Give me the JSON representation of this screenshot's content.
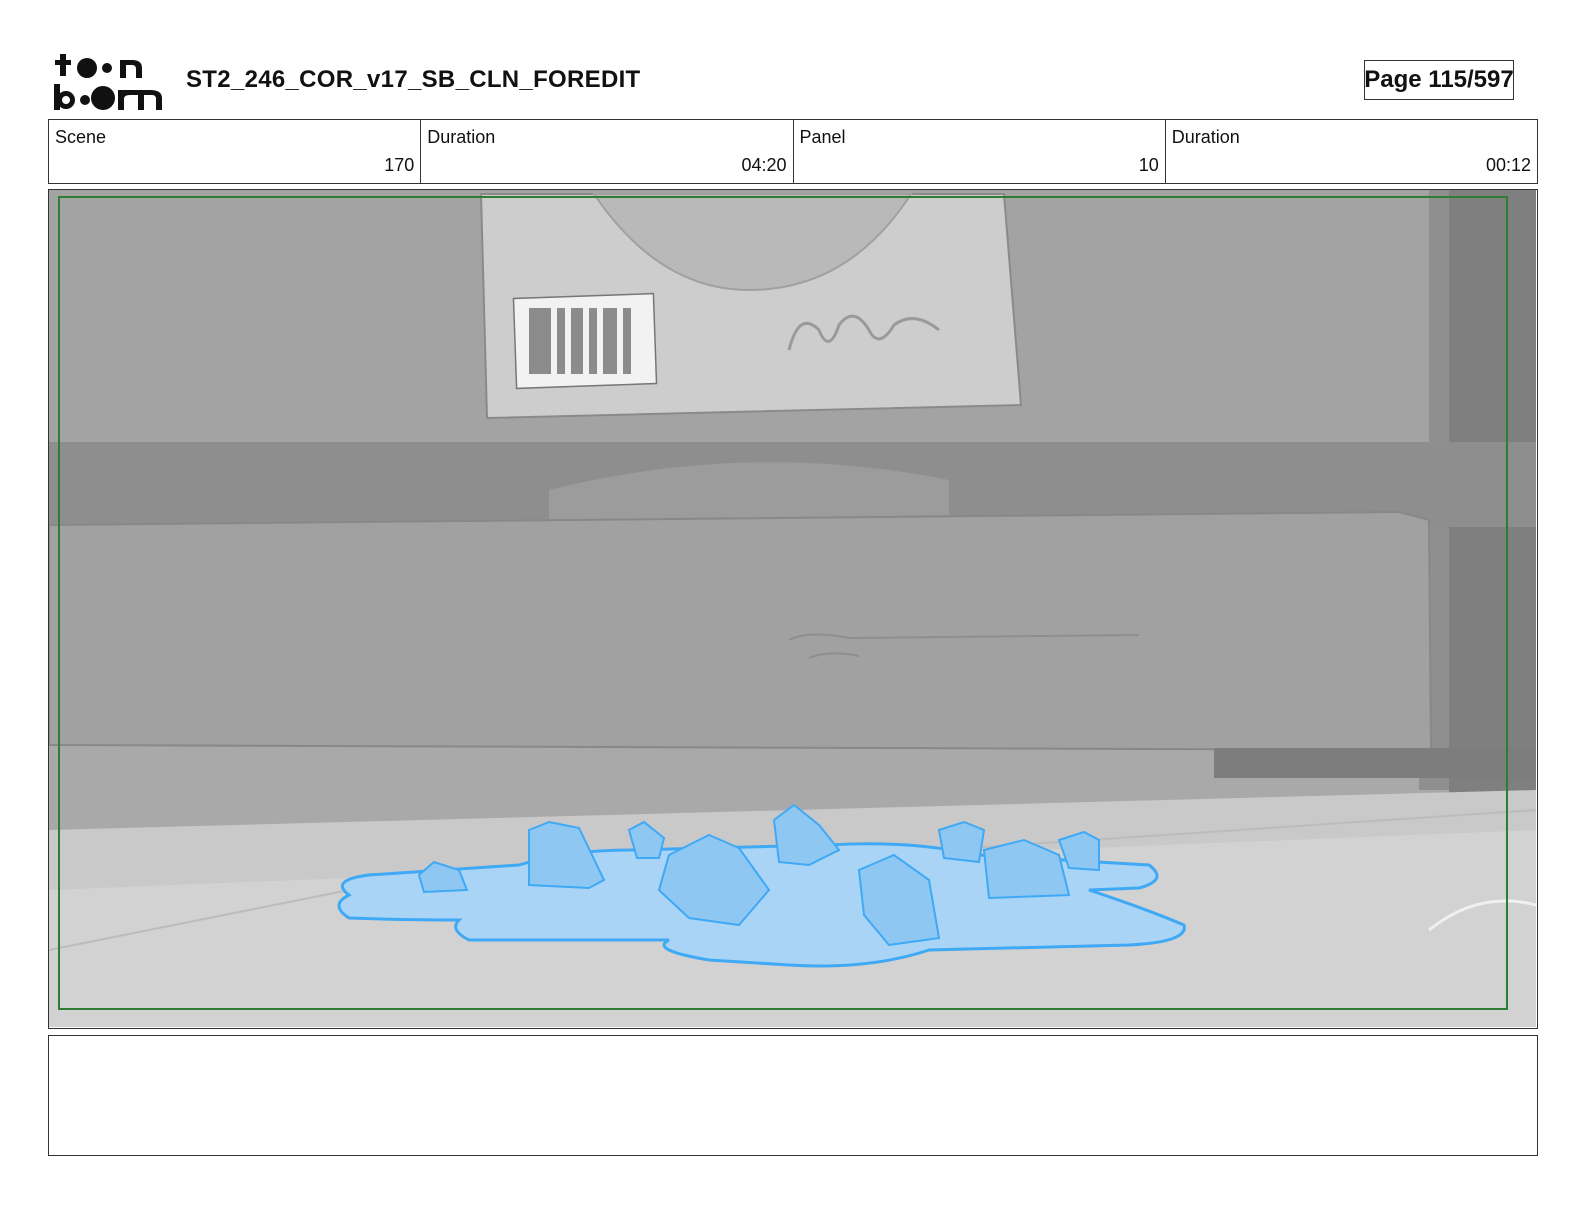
{
  "header": {
    "logo_text": "toon boom",
    "title": "ST2_246_COR_v17_SB_CLN_FOREDIT",
    "page_label": "Page 115/597"
  },
  "info": {
    "scene": {
      "label": "Scene",
      "value": "170"
    },
    "scene_duration": {
      "label": "Duration",
      "value": "04:20"
    },
    "panel": {
      "label": "Panel",
      "value": "10"
    },
    "panel_duration": {
      "label": "Duration",
      "value": "00:12"
    }
  },
  "panel_image": {
    "description_icon": "storyboard-drawing",
    "safe_frame_color": "#2e7d32",
    "puddle_fill": "#a9d4f5",
    "puddle_stroke": "#3fa9f5"
  },
  "notes": {
    "text": ""
  }
}
